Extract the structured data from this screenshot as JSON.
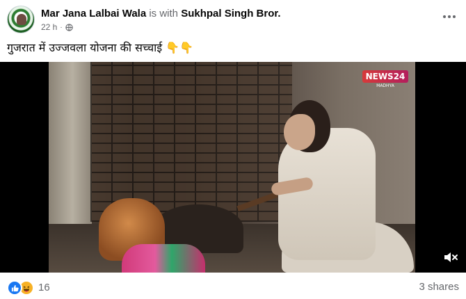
{
  "post": {
    "author": "Mar Jana Lalbai Wala",
    "with_text": "is with",
    "tagged": "Sukhpal Singh Bror.",
    "time": "22 h",
    "dot": "·",
    "caption": "गुजरात में उज्जवला योजना की सच्चाई 👇👇"
  },
  "video": {
    "channel_badge": "NEWS24",
    "channel_sub": "MADHYA"
  },
  "footer": {
    "reaction_count": "16",
    "shares": "3 shares"
  },
  "colors": {
    "like_blue": "#1877f2",
    "haha_yellow": "#f7b125",
    "secondary_text": "#65676b"
  },
  "icons": {
    "avatar": "page-avatar",
    "privacy": "globe-icon",
    "more": "more-options-icon",
    "mute": "volume-muted-icon",
    "like": "like-reaction-icon",
    "haha": "haha-reaction-icon"
  }
}
